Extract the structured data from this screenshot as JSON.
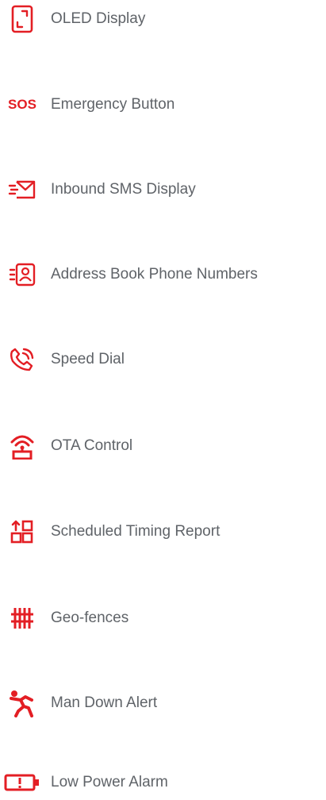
{
  "accent_color": "#e31e24",
  "text_color": "#5f6368",
  "features": [
    {
      "icon": "oled-display-icon",
      "label": "OLED Display"
    },
    {
      "icon": "sos-icon",
      "icon_text": "SOS",
      "label": "Emergency Button"
    },
    {
      "icon": "envelope-icon",
      "label": "Inbound SMS Display"
    },
    {
      "icon": "address-book-icon",
      "label": "Address Book Phone Numbers"
    },
    {
      "icon": "phone-call-icon",
      "label": "Speed Dial"
    },
    {
      "icon": "ota-tower-icon",
      "label": "OTA Control"
    },
    {
      "icon": "schedule-report-icon",
      "label": "Scheduled Timing Report"
    },
    {
      "icon": "geo-fence-icon",
      "label": "Geo-fences"
    },
    {
      "icon": "man-down-icon",
      "label": "Man Down Alert"
    },
    {
      "icon": "low-battery-icon",
      "label": "Low Power Alarm"
    }
  ]
}
